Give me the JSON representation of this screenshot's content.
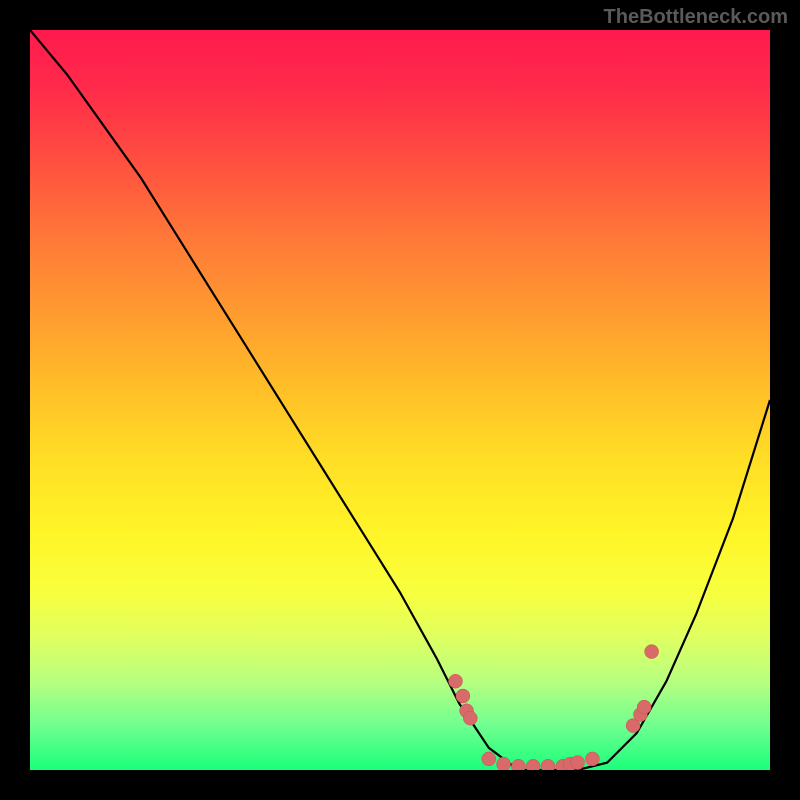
{
  "watermark": "TheBottleneck.com",
  "chart_data": {
    "type": "line",
    "title": "",
    "xlabel": "",
    "ylabel": "",
    "xlim": [
      0,
      100
    ],
    "ylim": [
      0,
      100
    ],
    "background_gradient": {
      "top": "#ff1a4d",
      "middle": "#ffde25",
      "bottom": "#1aff7a"
    },
    "series": [
      {
        "name": "bottleneck-curve",
        "type": "line",
        "color": "#000000",
        "x": [
          0,
          5,
          10,
          15,
          20,
          25,
          30,
          35,
          40,
          45,
          50,
          55,
          58,
          62,
          66,
          70,
          74,
          78,
          82,
          86,
          90,
          95,
          100
        ],
        "y": [
          100,
          94,
          87,
          80,
          72,
          64,
          56,
          48,
          40,
          32,
          24,
          15,
          9,
          3,
          0,
          0,
          0,
          1,
          5,
          12,
          21,
          34,
          50
        ]
      },
      {
        "name": "data-points",
        "type": "scatter",
        "color": "#d96a6a",
        "x": [
          57.5,
          58.5,
          59,
          59.5,
          62,
          64,
          66,
          68,
          70,
          72,
          73,
          74,
          76,
          81.5,
          82.5,
          83,
          84
        ],
        "y": [
          12,
          10,
          8,
          7,
          1.5,
          0.8,
          0.5,
          0.5,
          0.5,
          0.5,
          0.8,
          1,
          1.5,
          6,
          7.5,
          8.5,
          16
        ]
      }
    ]
  }
}
